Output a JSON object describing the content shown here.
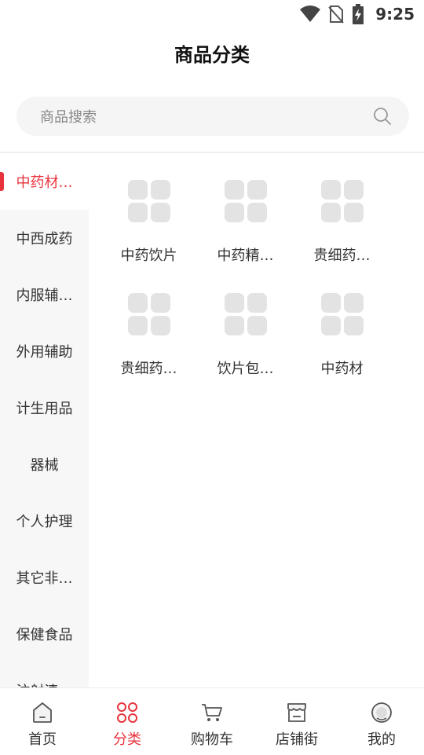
{
  "status_bar": {
    "time": "9:25"
  },
  "header": {
    "title": "商品分类"
  },
  "search": {
    "placeholder": "商品搜索"
  },
  "sidebar": {
    "items": [
      {
        "label": "中药材…",
        "active": true
      },
      {
        "label": "中西成药"
      },
      {
        "label": "内服辅…"
      },
      {
        "label": "外用辅助"
      },
      {
        "label": "计生用品"
      },
      {
        "label": "器械"
      },
      {
        "label": "个人护理"
      },
      {
        "label": "其它非…"
      },
      {
        "label": "保健食品"
      },
      {
        "label": "注射清…"
      }
    ]
  },
  "categories": [
    {
      "label": "中药饮片",
      "icon": "placeholder-grid-icon"
    },
    {
      "label": "中药精…",
      "icon": "placeholder-grid-icon"
    },
    {
      "label": "贵细药…",
      "icon": "placeholder-grid-icon"
    },
    {
      "label": "贵细药…",
      "icon": "placeholder-grid-icon"
    },
    {
      "label": "饮片包…",
      "icon": "placeholder-grid-icon"
    },
    {
      "label": "中药材",
      "icon": "placeholder-grid-icon"
    }
  ],
  "tabbar": {
    "items": [
      {
        "label": "首页",
        "icon": "home-icon"
      },
      {
        "label": "分类",
        "icon": "category-icon",
        "active": true
      },
      {
        "label": "购物车",
        "icon": "cart-icon"
      },
      {
        "label": "店铺街",
        "icon": "store-icon"
      },
      {
        "label": "我的",
        "icon": "profile-icon"
      }
    ]
  },
  "colors": {
    "accent": "#e8333c",
    "sidebar_bg": "#f7f7f7",
    "placeholder_tile": "#e3e3e3"
  }
}
